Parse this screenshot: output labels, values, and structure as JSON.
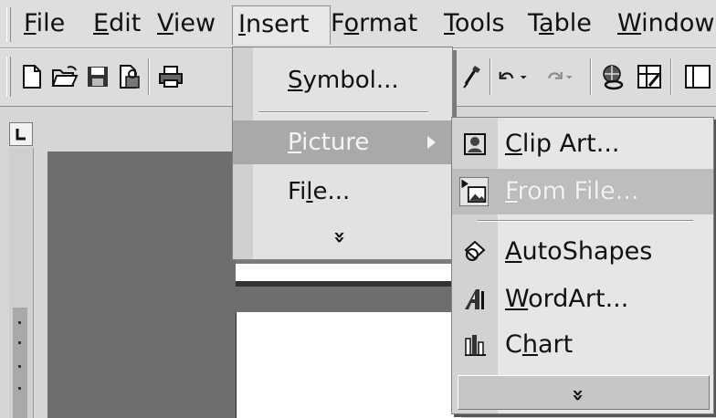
{
  "menubar": {
    "items": [
      {
        "pre": "",
        "mn": "F",
        "post": "ile"
      },
      {
        "pre": "",
        "mn": "E",
        "post": "dit"
      },
      {
        "pre": "",
        "mn": "V",
        "post": "iew"
      },
      {
        "pre": "",
        "mn": "I",
        "post": "nsert"
      },
      {
        "pre": "F",
        "mn": "o",
        "post": "rmat"
      },
      {
        "pre": "",
        "mn": "T",
        "post": "ools"
      },
      {
        "pre": "T",
        "mn": "a",
        "post": "ble"
      },
      {
        "pre": "",
        "mn": "W",
        "post": "indow"
      }
    ]
  },
  "toolbar": {
    "icons": [
      "new-document-icon",
      "open-folder-icon",
      "save-disk-icon",
      "permission-icon",
      "print-icon",
      "format-painter-icon",
      "undo-icon",
      "redo-icon",
      "hyperlink-icon",
      "tables-borders-icon"
    ]
  },
  "insert_menu": {
    "symbol": {
      "pre": "",
      "mn": "S",
      "post": "ymbol..."
    },
    "picture": {
      "pre": "",
      "mn": "P",
      "post": "icture"
    },
    "file": {
      "pre": "Fi",
      "mn": "l",
      "post": "e..."
    },
    "expand": "»"
  },
  "picture_submenu": {
    "clip_art": {
      "pre": "",
      "mn": "C",
      "post": "lip Art..."
    },
    "from_file": {
      "pre": "",
      "mn": "F",
      "post": "rom File..."
    },
    "autoshapes": {
      "pre": "",
      "mn": "A",
      "post": "utoShapes"
    },
    "wordart": {
      "pre": "",
      "mn": "W",
      "post": "ordArt..."
    },
    "chart": {
      "pre": "C",
      "mn": "h",
      "post": "art"
    },
    "expand": "»"
  },
  "colors": {
    "menu_bg": "#e2e2e2",
    "highlight": "#a9a9a9",
    "workspace": "#6e6e6e"
  }
}
